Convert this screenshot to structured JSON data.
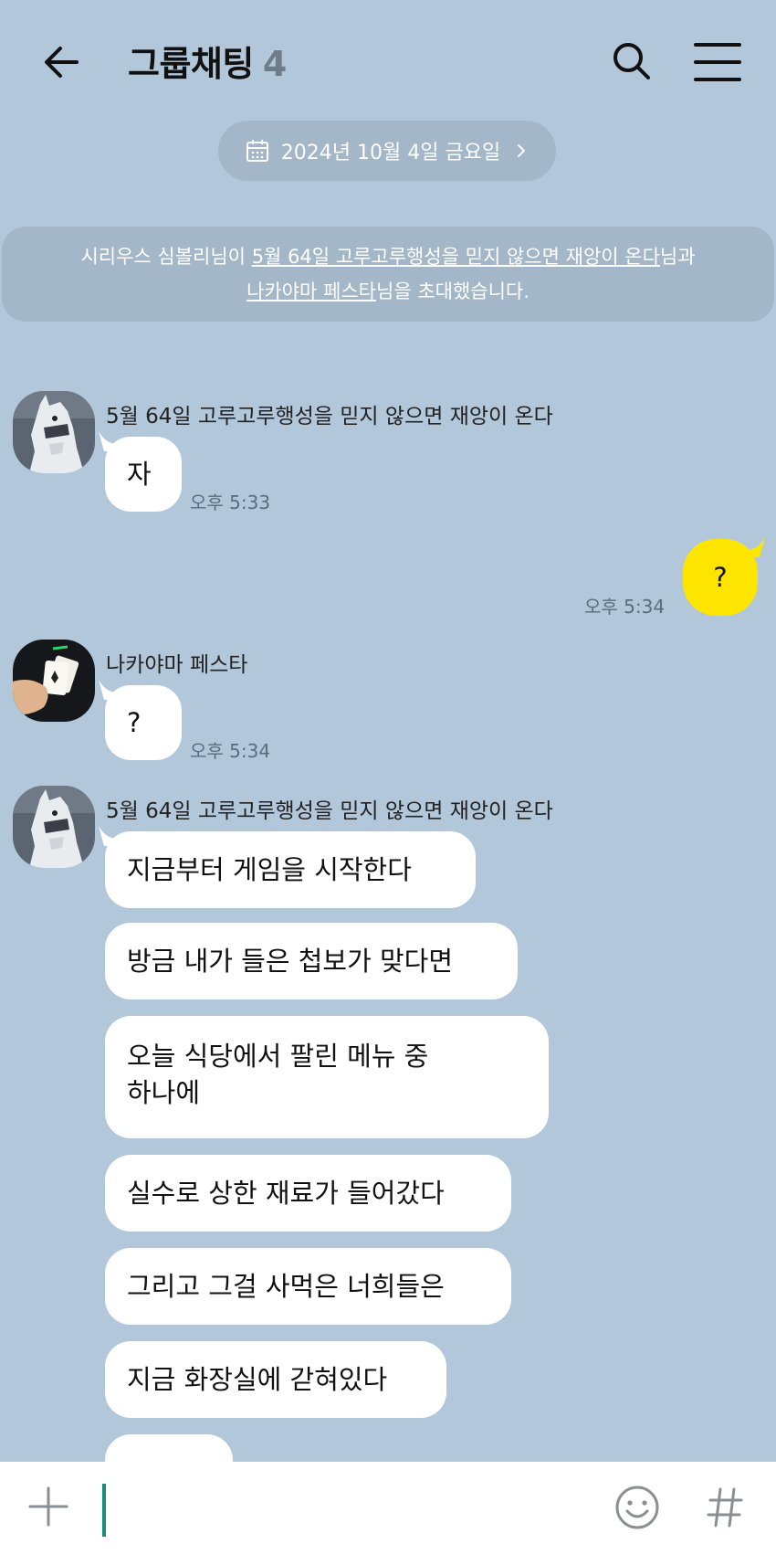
{
  "header": {
    "title": "그룹채팅",
    "member_count": "4",
    "back_icon": "back-arrow-icon",
    "search_icon": "search-icon",
    "menu_icon": "hamburger-menu-icon"
  },
  "date_divider": {
    "label": "2024년 10월 4일 금요일",
    "icon": "calendar-icon"
  },
  "system_message": {
    "inviter": "시리우스 심볼리",
    "part1": "님이 ",
    "invitee1": "5월 64일 고루고루행성을 믿지 않으면 재앙이 온다",
    "part2": "님과",
    "invitee2": "나카야마 페스타",
    "part3": "님을 초대했습니다."
  },
  "messages": [
    {
      "sender": "5월 64일 고루고루행성을 믿지 않으면 재앙이 온다",
      "avatar": "white-horse-mask-avatar",
      "bubbles": [
        {
          "text": "자",
          "time": "오후 5:33"
        }
      ]
    },
    {
      "sender": "me",
      "bubbles": [
        {
          "text": "?",
          "time": "오후 5:34"
        }
      ]
    },
    {
      "sender": "나카야마 페스타",
      "avatar": "playing-cards-hand-avatar",
      "bubbles": [
        {
          "text": "?",
          "time": "오후 5:34"
        }
      ]
    },
    {
      "sender": "5월 64일 고루고루행성을 믿지 않으면 재앙이 온다",
      "avatar": "white-horse-mask-avatar",
      "bubbles": [
        {
          "text": "지금부터 게임을 시작한다"
        },
        {
          "text": "방금 내가 들은 첩보가 맞다면"
        },
        {
          "line1": "오늘 식당에서 팔린 메뉴 중",
          "line2": "하나에"
        },
        {
          "text": "실수로 상한 재료가 들어갔다"
        },
        {
          "text": "그리고 그걸 사먹은 너희들은"
        },
        {
          "text": "지금 화장실에 갇혀있다"
        }
      ]
    }
  ],
  "input_bar": {
    "value": "",
    "plus_icon": "plus-icon",
    "emoji_icon": "emoji-smile-icon",
    "hash_icon": "hashtag-icon"
  },
  "colors": {
    "background": "#b2c7d9",
    "my_bubble": "#fee500",
    "other_bubble": "#ffffff",
    "caret": "#1b8c7a"
  }
}
